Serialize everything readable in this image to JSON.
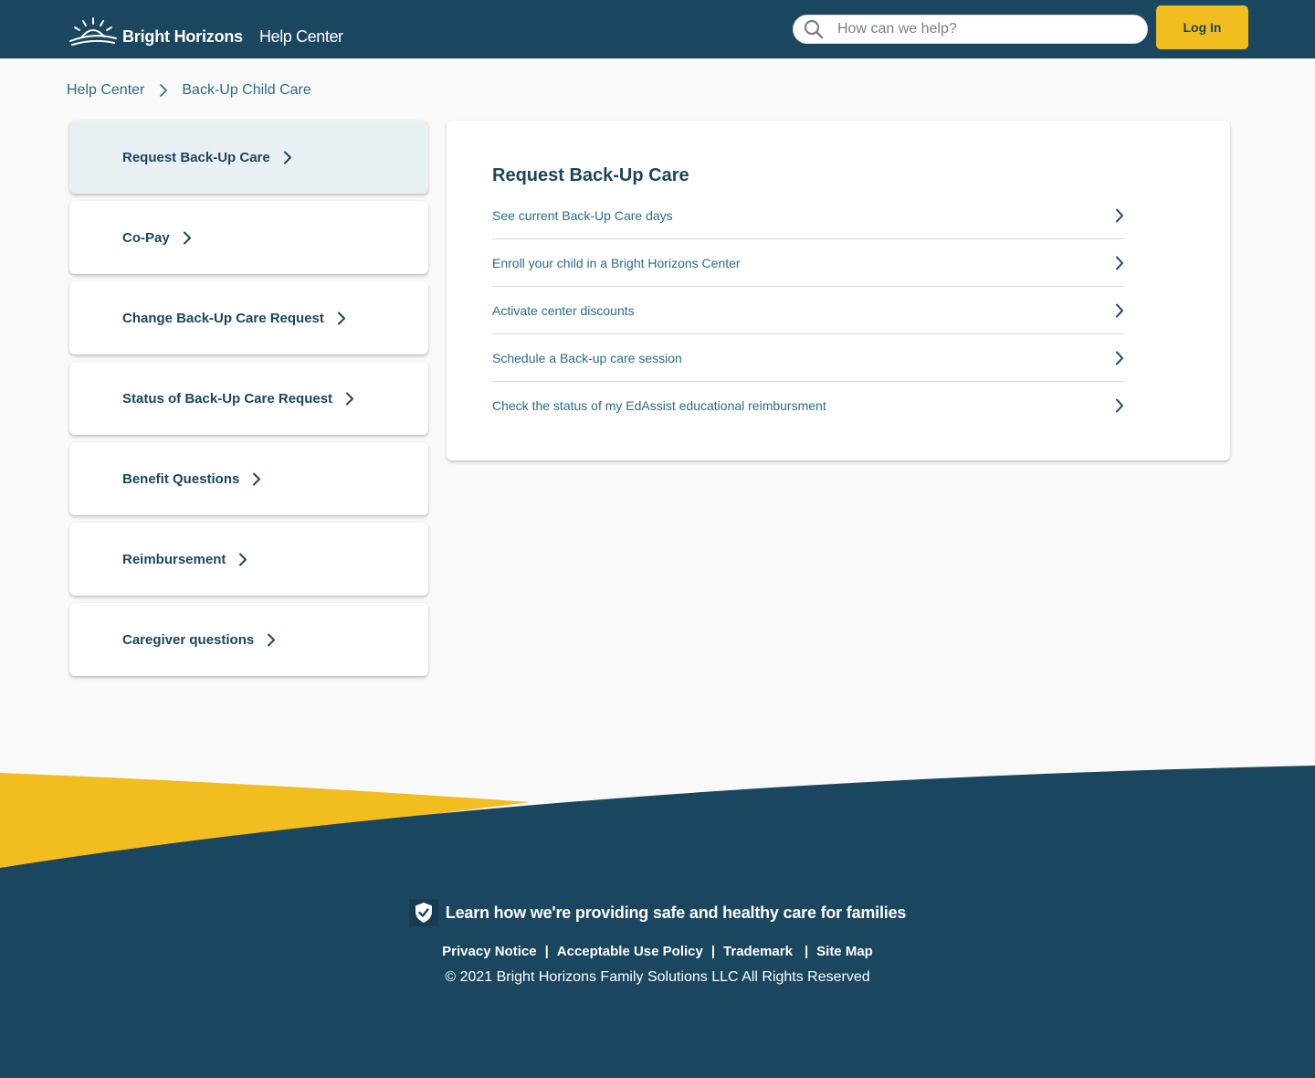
{
  "header": {
    "brand": "Bright Horizons",
    "section": "Help Center",
    "search_placeholder": "How can we help?",
    "login_label": "Log In"
  },
  "breadcrumb": {
    "items": [
      "Help Center",
      "Back-Up Child Care"
    ]
  },
  "sidebar": {
    "items": [
      {
        "label": "Request Back-Up Care",
        "active": true
      },
      {
        "label": "Co-Pay"
      },
      {
        "label": "Change Back-Up Care Request"
      },
      {
        "label": "Status of Back-Up Care Request"
      },
      {
        "label": "Benefit Questions"
      },
      {
        "label": "Reimbursement"
      },
      {
        "label": "Caregiver questions"
      }
    ]
  },
  "main": {
    "title": "Request Back-Up Care",
    "links": [
      "See current Back-Up Care days",
      "Enroll your child in a Bright Horizons Center",
      "Activate center discounts",
      "Schedule a Back-up care session",
      "Check the status of my EdAssist educational reimbursment"
    ]
  },
  "footer": {
    "tagline": "Learn how we're providing safe and healthy care for families",
    "links": [
      "Privacy Notice",
      "Acceptable Use Policy",
      "Trademark",
      "Site Map"
    ],
    "copyright": "© 2021 Bright Horizons Family Solutions LLC All Rights Reserved"
  },
  "icons": {
    "logo": "sun-horizon-icon",
    "search": "search-icon",
    "chevron": "chevron-right-icon",
    "shield": "shield-check-icon"
  },
  "colors": {
    "navy": "#1b465f",
    "yellow": "#f2bd1f",
    "link": "#2b6d86",
    "active_bg": "#e9f0f4",
    "page_bg": "#f9f9f9"
  }
}
